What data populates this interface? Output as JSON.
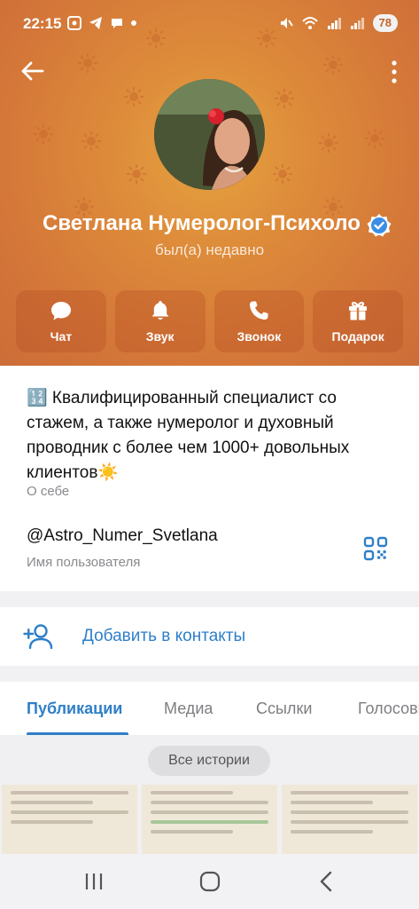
{
  "status_bar": {
    "time": "22:15",
    "battery": "78"
  },
  "profile": {
    "name": "Светлана Нумеролог-Психолог",
    "status": "был(а) недавно"
  },
  "actions": [
    {
      "label": "Чат",
      "icon": "chat-icon"
    },
    {
      "label": "Звук",
      "icon": "bell-icon"
    },
    {
      "label": "Звонок",
      "icon": "phone-icon"
    },
    {
      "label": "Подарок",
      "icon": "gift-icon"
    }
  ],
  "info": {
    "bio": "🔢 Квалифицированный специалист со стажем, а также нумеролог и духовный проводник с более чем 1000+ довольных клиентов☀️",
    "bio_label": "О себе",
    "username": "@Astro_Numer_Svetlana",
    "username_label": "Имя пользователя"
  },
  "add_contact": {
    "label": "Добавить в контакты"
  },
  "tabs": [
    {
      "label": "Публикации",
      "active": true
    },
    {
      "label": "Медиа",
      "active": false
    },
    {
      "label": "Ссылки",
      "active": false
    },
    {
      "label": "Голосовые",
      "active": false
    }
  ],
  "stories": {
    "all_label": "Все истории"
  },
  "colors": {
    "header": "#d9803a",
    "accent": "#2f7fc8",
    "verified": "#3a8ee6"
  }
}
